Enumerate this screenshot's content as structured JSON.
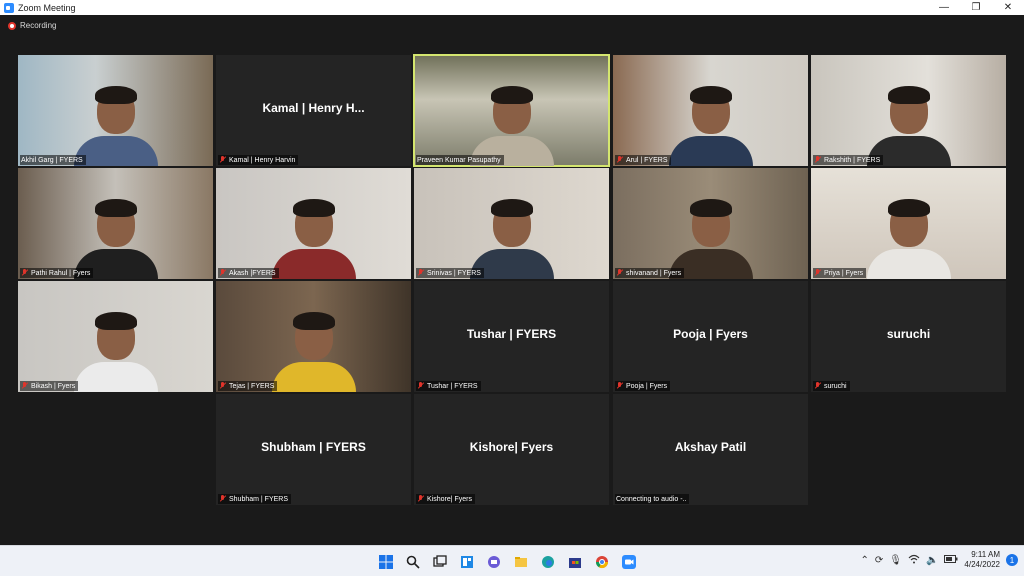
{
  "window": {
    "title": "Zoom Meeting",
    "minimize": "—",
    "restore": "❐",
    "close": "✕"
  },
  "recording": {
    "label": "Recording"
  },
  "tiles": [
    {
      "label": "Akhil Garg | FYERS"
    },
    {
      "center": "Kamal | Henry H...",
      "label": "Kamal | Henry Harvin"
    },
    {
      "label": "Praveen Kumar Pasupathy"
    },
    {
      "label": "Arul | FYERS"
    },
    {
      "label": "Rakshith | FYERS"
    },
    {
      "label": "Pathi Rahul | Fyers"
    },
    {
      "label": "Akash |FYERS"
    },
    {
      "label": "Srinivas | FYERS"
    },
    {
      "label": "shivanand | Fyers"
    },
    {
      "label": "Priya | Fyers"
    },
    {
      "label": "Bikash | Fyers"
    },
    {
      "label": "Tejas | FYERS"
    },
    {
      "center": "Tushar | FYERS",
      "label": "Tushar | FYERS"
    },
    {
      "center": "Pooja | Fyers",
      "label": "Pooja | Fyers"
    },
    {
      "center": "suruchi",
      "label": "suruchi"
    },
    {
      "center": "Shubham | FYERS",
      "label": "Shubham | FYERS"
    },
    {
      "center": "Kishore| Fyers",
      "label": "Kishore| Fyers"
    },
    {
      "center": "Akshay Patil",
      "label": "Connecting to audio -.."
    }
  ],
  "taskbar": {
    "time": "9:11 AM",
    "date": "4/24/2022",
    "notifications": "1"
  }
}
